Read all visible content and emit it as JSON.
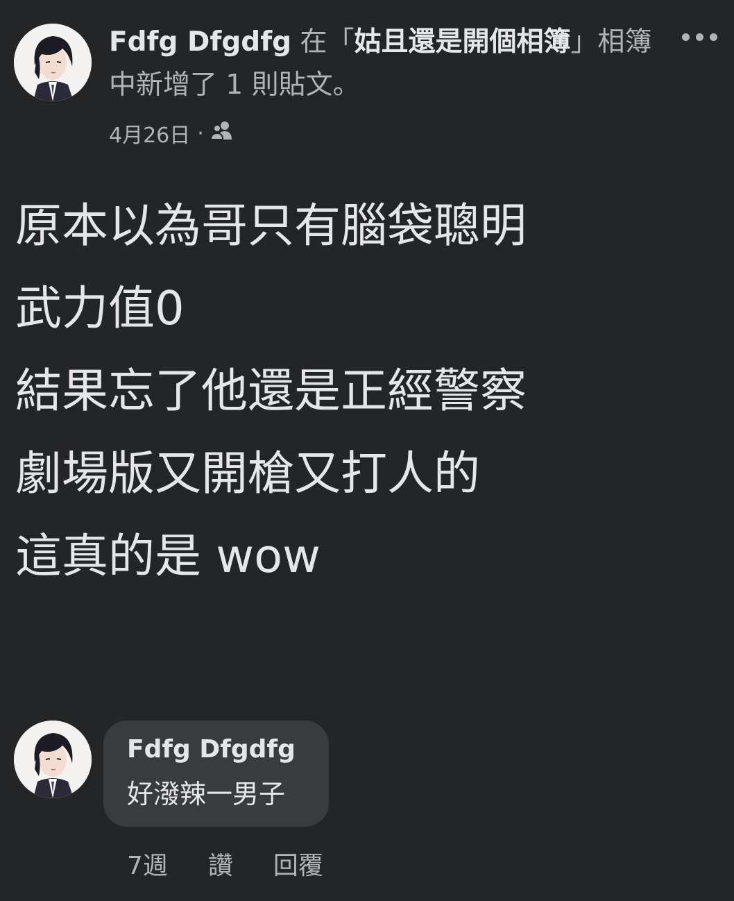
{
  "post": {
    "author": "Fdfg Dfgdfg",
    "header_mid": " 在「",
    "album": "姑且還是開個相簿",
    "header_tail": "」相簿中新增了 1 則貼文。",
    "date": "4月26日",
    "separator": " · ",
    "audience_icon": "friends-icon",
    "more_icon": "more-options-icon",
    "body_lines": [
      "原本以為哥只有腦袋聰明",
      "武力值0",
      "結果忘了他還是正經警察",
      "劇場版又開槍又打人的",
      "這真的是 wow"
    ]
  },
  "comment": {
    "author": "Fdfg Dfgdfg",
    "text": "好潑辣一男子",
    "time": "7週",
    "like_label": "讚",
    "reply_label": "回覆"
  },
  "colors": {
    "background": "#242526",
    "bubble": "#3a3b3c",
    "primary_text": "#e4e6eb",
    "secondary_text": "#b0b3b8"
  }
}
